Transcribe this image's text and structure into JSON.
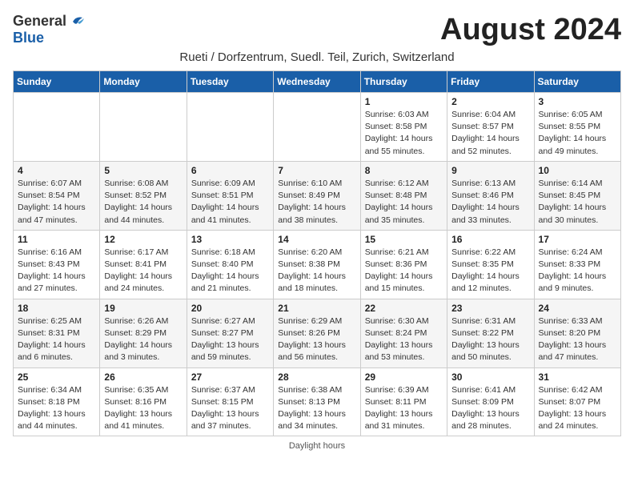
{
  "header": {
    "logo_general": "General",
    "logo_blue": "Blue",
    "month_title": "August 2024",
    "subtitle": "Rueti / Dorfzentrum, Suedl. Teil, Zurich, Switzerland"
  },
  "days_of_week": [
    "Sunday",
    "Monday",
    "Tuesday",
    "Wednesday",
    "Thursday",
    "Friday",
    "Saturday"
  ],
  "daylight_note": "Daylight hours",
  "weeks": [
    {
      "days": [
        {
          "number": "",
          "info": ""
        },
        {
          "number": "",
          "info": ""
        },
        {
          "number": "",
          "info": ""
        },
        {
          "number": "",
          "info": ""
        },
        {
          "number": "1",
          "info": "Sunrise: 6:03 AM\nSunset: 8:58 PM\nDaylight: 14 hours and 55 minutes."
        },
        {
          "number": "2",
          "info": "Sunrise: 6:04 AM\nSunset: 8:57 PM\nDaylight: 14 hours and 52 minutes."
        },
        {
          "number": "3",
          "info": "Sunrise: 6:05 AM\nSunset: 8:55 PM\nDaylight: 14 hours and 49 minutes."
        }
      ]
    },
    {
      "days": [
        {
          "number": "4",
          "info": "Sunrise: 6:07 AM\nSunset: 8:54 PM\nDaylight: 14 hours and 47 minutes."
        },
        {
          "number": "5",
          "info": "Sunrise: 6:08 AM\nSunset: 8:52 PM\nDaylight: 14 hours and 44 minutes."
        },
        {
          "number": "6",
          "info": "Sunrise: 6:09 AM\nSunset: 8:51 PM\nDaylight: 14 hours and 41 minutes."
        },
        {
          "number": "7",
          "info": "Sunrise: 6:10 AM\nSunset: 8:49 PM\nDaylight: 14 hours and 38 minutes."
        },
        {
          "number": "8",
          "info": "Sunrise: 6:12 AM\nSunset: 8:48 PM\nDaylight: 14 hours and 35 minutes."
        },
        {
          "number": "9",
          "info": "Sunrise: 6:13 AM\nSunset: 8:46 PM\nDaylight: 14 hours and 33 minutes."
        },
        {
          "number": "10",
          "info": "Sunrise: 6:14 AM\nSunset: 8:45 PM\nDaylight: 14 hours and 30 minutes."
        }
      ]
    },
    {
      "days": [
        {
          "number": "11",
          "info": "Sunrise: 6:16 AM\nSunset: 8:43 PM\nDaylight: 14 hours and 27 minutes."
        },
        {
          "number": "12",
          "info": "Sunrise: 6:17 AM\nSunset: 8:41 PM\nDaylight: 14 hours and 24 minutes."
        },
        {
          "number": "13",
          "info": "Sunrise: 6:18 AM\nSunset: 8:40 PM\nDaylight: 14 hours and 21 minutes."
        },
        {
          "number": "14",
          "info": "Sunrise: 6:20 AM\nSunset: 8:38 PM\nDaylight: 14 hours and 18 minutes."
        },
        {
          "number": "15",
          "info": "Sunrise: 6:21 AM\nSunset: 8:36 PM\nDaylight: 14 hours and 15 minutes."
        },
        {
          "number": "16",
          "info": "Sunrise: 6:22 AM\nSunset: 8:35 PM\nDaylight: 14 hours and 12 minutes."
        },
        {
          "number": "17",
          "info": "Sunrise: 6:24 AM\nSunset: 8:33 PM\nDaylight: 14 hours and 9 minutes."
        }
      ]
    },
    {
      "days": [
        {
          "number": "18",
          "info": "Sunrise: 6:25 AM\nSunset: 8:31 PM\nDaylight: 14 hours and 6 minutes."
        },
        {
          "number": "19",
          "info": "Sunrise: 6:26 AM\nSunset: 8:29 PM\nDaylight: 14 hours and 3 minutes."
        },
        {
          "number": "20",
          "info": "Sunrise: 6:27 AM\nSunset: 8:27 PM\nDaylight: 13 hours and 59 minutes."
        },
        {
          "number": "21",
          "info": "Sunrise: 6:29 AM\nSunset: 8:26 PM\nDaylight: 13 hours and 56 minutes."
        },
        {
          "number": "22",
          "info": "Sunrise: 6:30 AM\nSunset: 8:24 PM\nDaylight: 13 hours and 53 minutes."
        },
        {
          "number": "23",
          "info": "Sunrise: 6:31 AM\nSunset: 8:22 PM\nDaylight: 13 hours and 50 minutes."
        },
        {
          "number": "24",
          "info": "Sunrise: 6:33 AM\nSunset: 8:20 PM\nDaylight: 13 hours and 47 minutes."
        }
      ]
    },
    {
      "days": [
        {
          "number": "25",
          "info": "Sunrise: 6:34 AM\nSunset: 8:18 PM\nDaylight: 13 hours and 44 minutes."
        },
        {
          "number": "26",
          "info": "Sunrise: 6:35 AM\nSunset: 8:16 PM\nDaylight: 13 hours and 41 minutes."
        },
        {
          "number": "27",
          "info": "Sunrise: 6:37 AM\nSunset: 8:15 PM\nDaylight: 13 hours and 37 minutes."
        },
        {
          "number": "28",
          "info": "Sunrise: 6:38 AM\nSunset: 8:13 PM\nDaylight: 13 hours and 34 minutes."
        },
        {
          "number": "29",
          "info": "Sunrise: 6:39 AM\nSunset: 8:11 PM\nDaylight: 13 hours and 31 minutes."
        },
        {
          "number": "30",
          "info": "Sunrise: 6:41 AM\nSunset: 8:09 PM\nDaylight: 13 hours and 28 minutes."
        },
        {
          "number": "31",
          "info": "Sunrise: 6:42 AM\nSunset: 8:07 PM\nDaylight: 13 hours and 24 minutes."
        }
      ]
    }
  ]
}
